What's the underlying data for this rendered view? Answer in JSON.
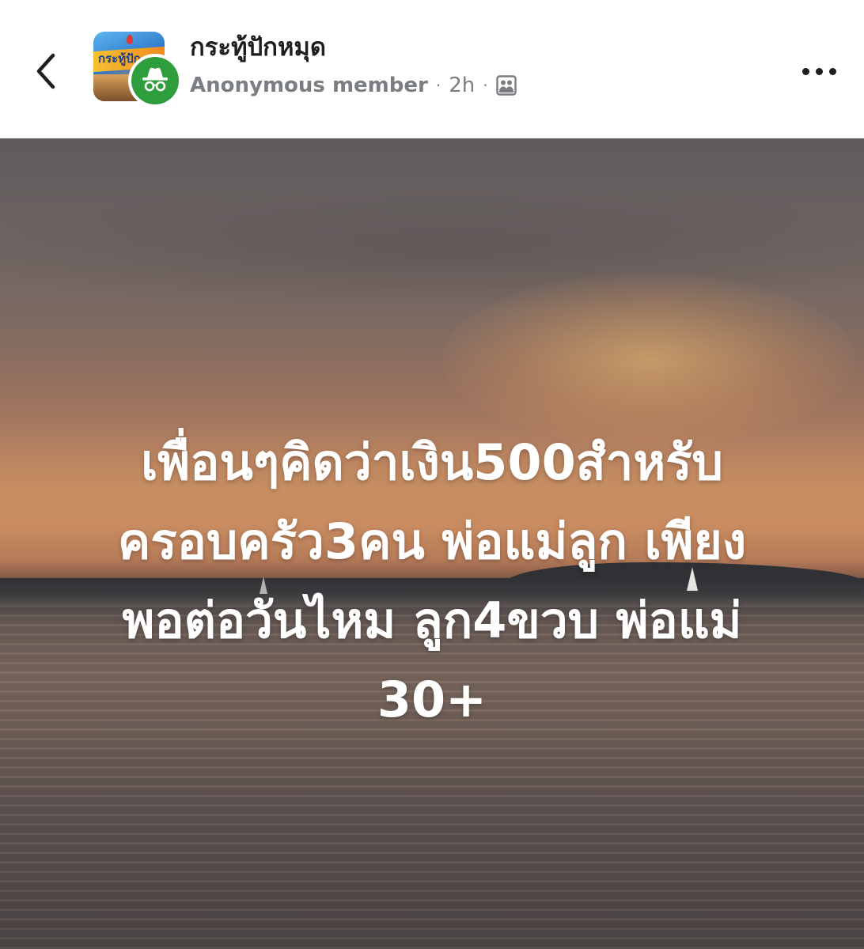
{
  "header": {
    "group_name": "กระทู้ปักหมุด",
    "avatar_logo_text": "กระทู้ปัก",
    "author": "Anonymous member",
    "time": "2h",
    "separator": "·",
    "audience_icon": "group-audience-icon",
    "back_icon": "chevron-left-icon",
    "more_icon": "more-horizontal-icon"
  },
  "post": {
    "lines": [
      "เพื่อนๆคิดว่าเงิน500สำหรับ",
      "ครอบครัว3คน พ่อแม่ลูก เพียง",
      "พอต่อวันไหม ลูก4ขวบ พ่อแม่",
      "30+"
    ],
    "text_color": "#ffffff",
    "background": "sunset-over-lake"
  },
  "colors": {
    "anonymous_badge": "#2e9e3c",
    "secondary_text": "#7a7d82",
    "primary_text": "#1c1e21"
  }
}
